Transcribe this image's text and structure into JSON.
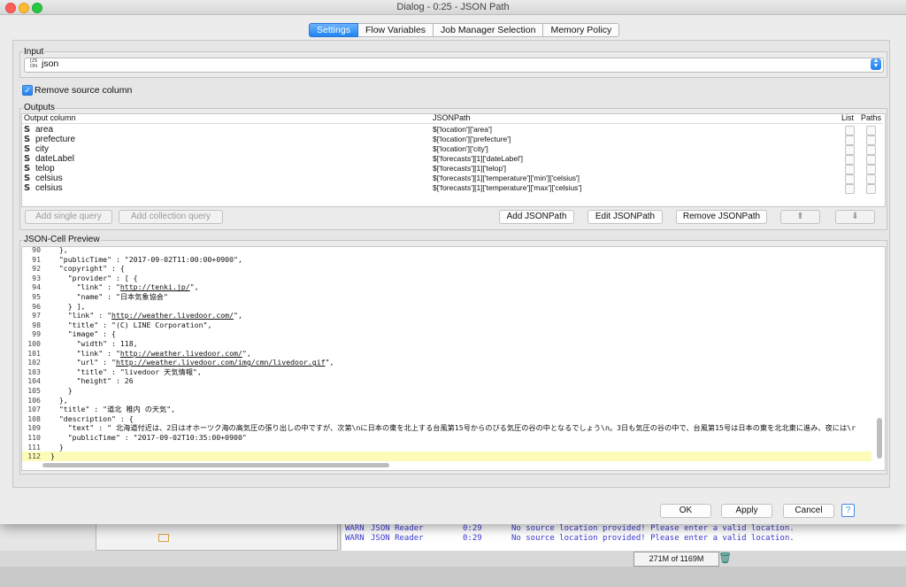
{
  "window": {
    "title": "Dialog - 0:25 - JSON Path"
  },
  "tabs": [
    {
      "label": "Settings",
      "active": true
    },
    {
      "label": "Flow Variables",
      "active": false
    },
    {
      "label": "Job Manager Selection",
      "active": false
    },
    {
      "label": "Memory Policy",
      "active": false
    }
  ],
  "input": {
    "group_label": "Input",
    "icon_text": "{JS\nON",
    "value": "json"
  },
  "remove_source": {
    "label": "Remove source column",
    "checked": true
  },
  "outputs": {
    "group_label": "Outputs",
    "headers": {
      "column": "Output column",
      "path": "JSONPath",
      "list": "List",
      "paths": "Paths"
    },
    "type_icon": "S",
    "rows": [
      {
        "name": "area",
        "path": "$['location']['area']"
      },
      {
        "name": "prefecture",
        "path": "$['location']['prefecture']"
      },
      {
        "name": "city",
        "path": "$['location']['city']"
      },
      {
        "name": "dateLabel",
        "path": "$['forecasts'][1]['dateLabel']"
      },
      {
        "name": "telop",
        "path": "$['forecasts'][1]['telop']"
      },
      {
        "name": "celsius",
        "path": "$['forecasts'][1]['temperature']['min']['celsius']"
      },
      {
        "name": "celsius",
        "path": "$['forecasts'][1]['temperature']['max']['celsius']"
      }
    ],
    "buttons": {
      "add_single": "Add single query",
      "add_collection": "Add collection query",
      "add_jsonpath": "Add JSONPath",
      "edit_jsonpath": "Edit JSONPath",
      "remove_jsonpath": "Remove JSONPath",
      "up": "⬆",
      "down": "⬇"
    }
  },
  "preview": {
    "group_label": "JSON-Cell Preview",
    "lines": [
      {
        "n": "90",
        "t": "  },"
      },
      {
        "n": "91",
        "t": "  \"publicTime\" : \"2017-09-02T11:00:00+0900\","
      },
      {
        "n": "92",
        "t": "  \"copyright\" : {"
      },
      {
        "n": "93",
        "t": "    \"provider\" : [ {"
      },
      {
        "n": "94",
        "t": "      \"link\" : \"http://tenki.jp/\","
      },
      {
        "n": "95",
        "t": "      \"name\" : \"日本気象協会\""
      },
      {
        "n": "96",
        "t": "    } ],"
      },
      {
        "n": "97",
        "t": "    \"link\" : \"http://weather.livedoor.com/\","
      },
      {
        "n": "98",
        "t": "    \"title\" : \"(C) LINE Corporation\","
      },
      {
        "n": "99",
        "t": "    \"image\" : {"
      },
      {
        "n": "100",
        "t": "      \"width\" : 118,"
      },
      {
        "n": "101",
        "t": "      \"link\" : \"http://weather.livedoor.com/\","
      },
      {
        "n": "102",
        "t": "      \"url\" : \"http://weather.livedoor.com/img/cmn/livedoor.gif\","
      },
      {
        "n": "103",
        "t": "      \"title\" : \"livedoor 天気情報\","
      },
      {
        "n": "104",
        "t": "      \"height\" : 26"
      },
      {
        "n": "105",
        "t": "    }"
      },
      {
        "n": "106",
        "t": "  },"
      },
      {
        "n": "107",
        "t": "  \"title\" : \"道北 稚内 の天気\","
      },
      {
        "n": "108",
        "t": "  \"description\" : {"
      },
      {
        "n": "109",
        "t": "    \"text\" : \" 北海道付近は、2日はオホーツク海の高気圧の張り出しの中ですが、次第\\nに日本の東を北上する台風第15号からのびる気圧の谷の中となるでしょう\\n。3日も気圧の谷の中で、台風第15号は日本の東を北北東に進み、夜には\\r"
      },
      {
        "n": "110",
        "t": "    \"publicTime\" : \"2017-09-02T10:35:00+0900\""
      },
      {
        "n": "111",
        "t": "  }"
      },
      {
        "n": "112",
        "t": "}"
      }
    ]
  },
  "footer": {
    "ok": "OK",
    "apply": "Apply",
    "cancel": "Cancel",
    "help": "?"
  },
  "console": {
    "lines": [
      {
        "level": "WARN",
        "source": "JSON Reader",
        "node": "0:29",
        "message": "No source location provided! Please enter a valid location."
      },
      {
        "level": "WARN",
        "source": "JSON Reader",
        "node": "0:29",
        "message": "No source location provided! Please enter a valid location."
      }
    ]
  },
  "status": {
    "heap": "271M of 1169M"
  },
  "colors": {
    "accent": "#1f84f2",
    "highlight_line": "#fdfbb8",
    "console_text": "#3a3ad0"
  }
}
